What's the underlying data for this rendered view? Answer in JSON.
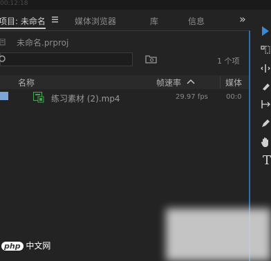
{
  "timecode": "00:12:18",
  "tabs": {
    "project": "项目: 未命名",
    "media_browser": "媒体浏览器",
    "library": "库",
    "info": "信息",
    "overflow": "»"
  },
  "project_file": "未命名.prproj",
  "item_count": "1 个项",
  "columns": {
    "name": "名称",
    "frame_rate": "帧速率",
    "media": "媒体"
  },
  "files": [
    {
      "name": "练习素材 (2).mp4",
      "frame_rate": "29.97 fps",
      "media_start": "00:0"
    }
  ],
  "watermark": {
    "badge": "php",
    "text": "中文网"
  },
  "colors": {
    "accent": "#2d6fb3",
    "background": "#232323",
    "text": "#8c8c8c",
    "file_icon": "#3fa84a"
  }
}
